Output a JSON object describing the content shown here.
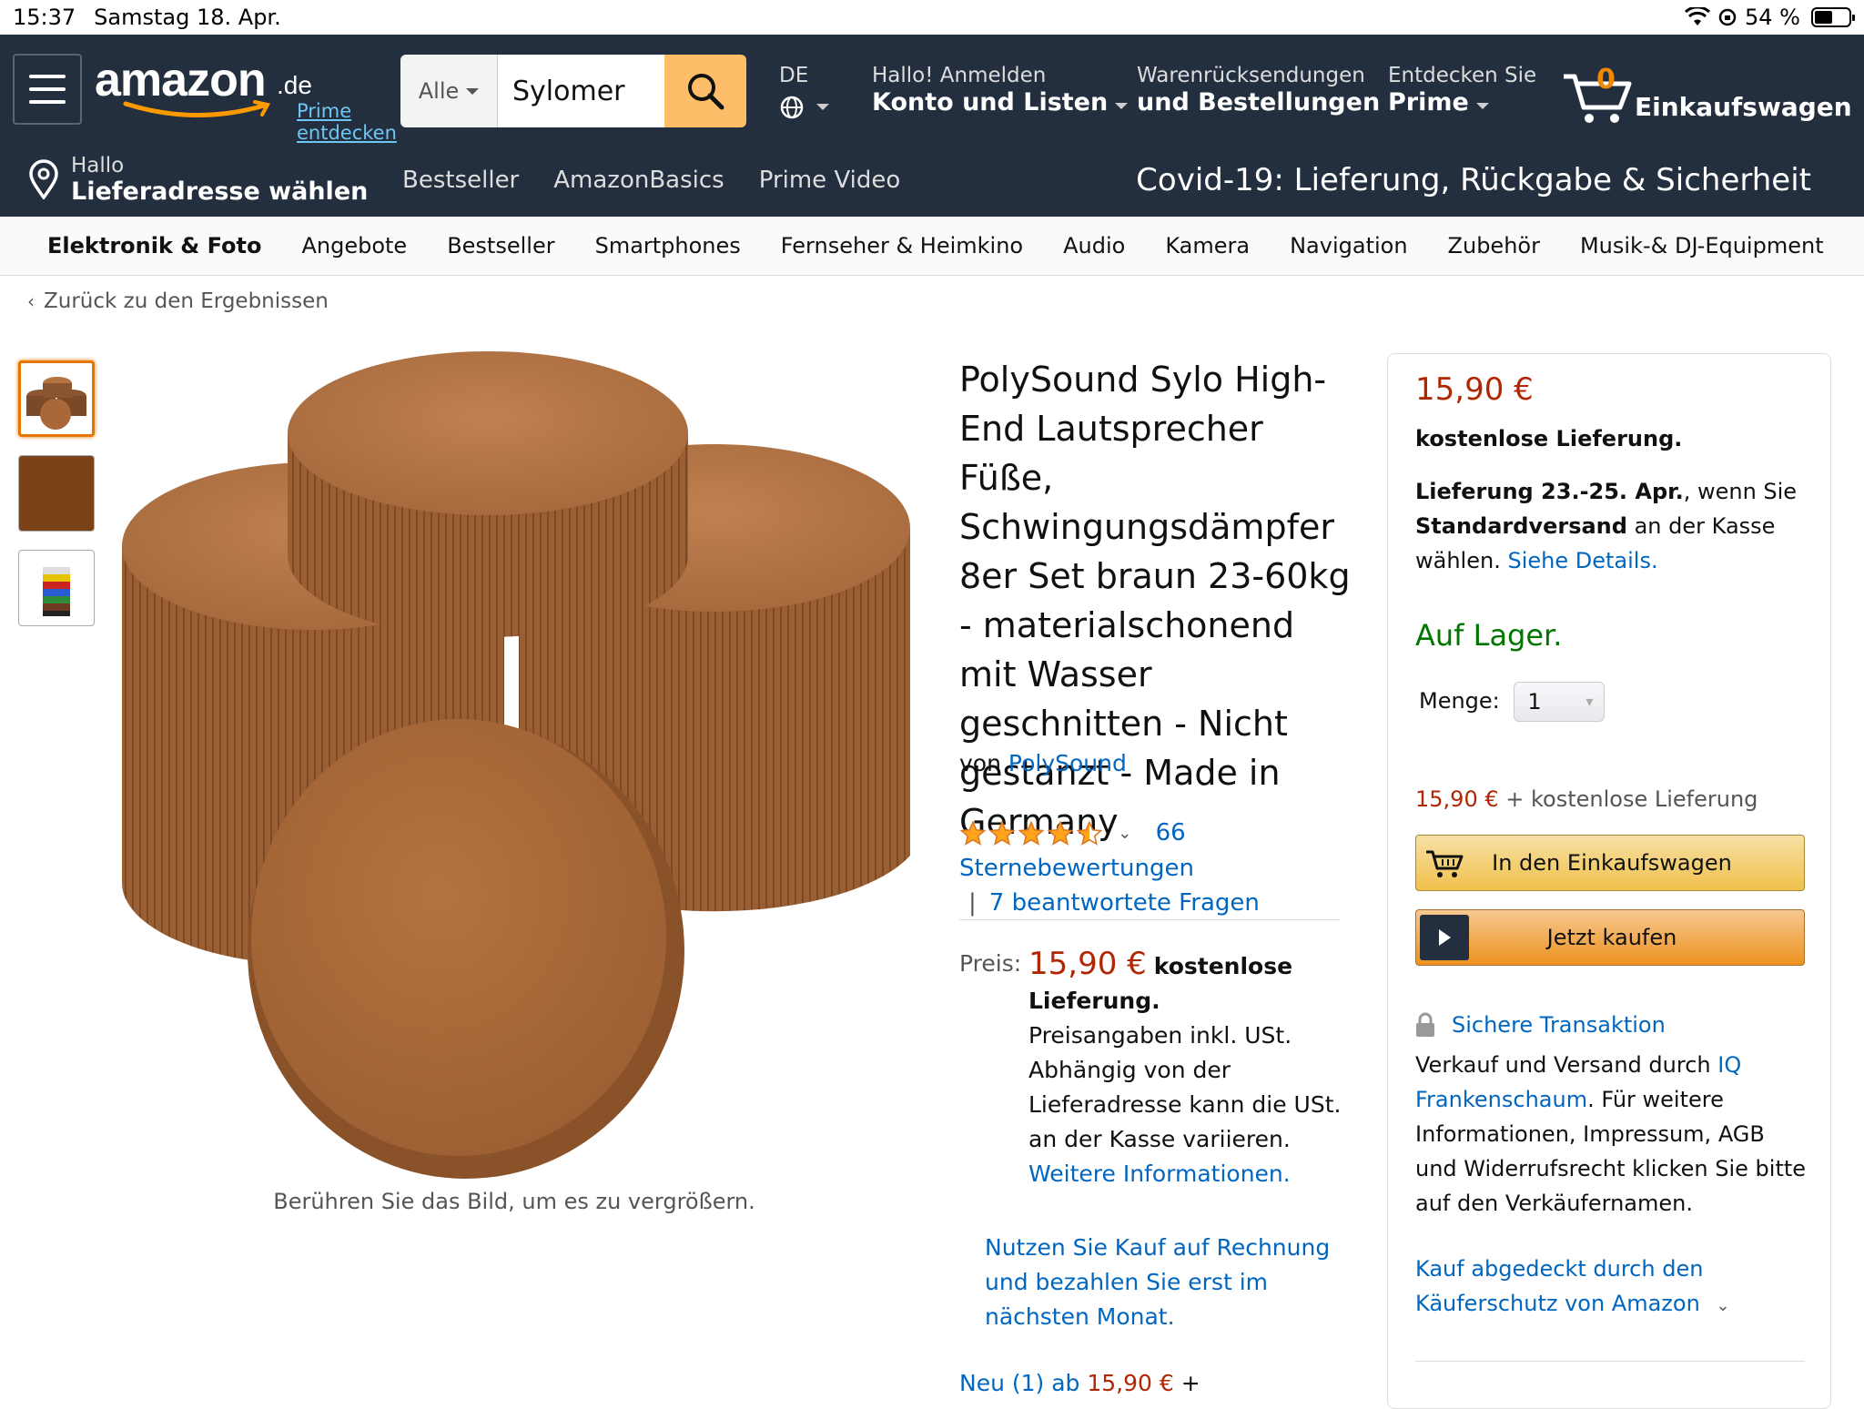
{
  "status": {
    "time": "15:37",
    "date": "Samstag 18. Apr.",
    "battery": "54 %",
    "battery_level": 0.54
  },
  "header": {
    "logo_text": "amazon",
    "logo_tld": ".de",
    "prime_link": "Prime entdecken",
    "search": {
      "department": "Alle",
      "query": "Sylomer"
    },
    "language": "DE",
    "account": {
      "line1": "Hallo! Anmelden",
      "line2": "Konto und Listen"
    },
    "orders": {
      "line1": "Warenrücksendungen",
      "line2": "und Bestellungen"
    },
    "prime": {
      "line1": "Entdecken Sie",
      "line2": "Prime"
    },
    "cart": {
      "count": "0",
      "label": "Einkaufswagen"
    }
  },
  "subnav": {
    "location": {
      "line1": "Hallo",
      "line2": "Lieferadresse wählen"
    },
    "links": [
      "Bestseller",
      "AmazonBasics",
      "Prime Video"
    ],
    "banner": "Covid-19: Lieferung, Rückgabe & Sicherheit"
  },
  "categories": [
    "Elektronik & Foto",
    "Angebote",
    "Bestseller",
    "Smartphones",
    "Fernseher & Heimkino",
    "Audio",
    "Kamera",
    "Navigation",
    "Zubehör",
    "Musik-& DJ-Equipment"
  ],
  "back_link": "Zurück zu den Ergebnissen",
  "image_caption": "Berühren Sie das Bild, um es zu vergrößern.",
  "product": {
    "title": "PolySound Sylo High-End Lautsprecher Füße, Schwingungsdämpfer 8er Set braun 23-60kg - materialschonend mit Wasser geschnitten - Nicht gestanzt - Made in Germany",
    "by_label": "von",
    "brand": "PolySound",
    "rating_stars": 4.5,
    "rating_count": "66",
    "rating_label": "Sternebewertungen",
    "questions": "7 beantwortete Fragen",
    "price_label": "Preis:",
    "price": "15,90 €",
    "free_delivery": "kostenlose Lieferung.",
    "tax_note": "Preisangaben inkl. USt. Abhängig von der Lieferadresse kann die USt. an der Kasse variieren.",
    "more_info": "Weitere Informationen.",
    "invoice_promo": "Nutzen Sie Kauf auf Rechnung und bezahlen Sie erst im nächsten Monat.",
    "new_offers": "Neu (1) ab",
    "new_price": "15,90 €",
    "new_suffix": "+"
  },
  "buybox": {
    "price": "15,90 €",
    "free_delivery": "kostenlose Lieferung.",
    "delivery_bold": "Lieferung 23.-25. Apr.",
    "delivery_mid": ", wenn Sie",
    "delivery_shipping": "Standardversand",
    "delivery_rest": "an der Kasse wählen.",
    "details_link": "Siehe Details.",
    "stock": "Auf Lager.",
    "qty_label": "Menge:",
    "qty_value": "1",
    "summary_price": "15,90 €",
    "summary_rest": "+ kostenlose Lieferung",
    "add_to_cart": "In den Einkaufswagen",
    "buy_now": "Jetzt kaufen",
    "secure": "Sichere Transaktion",
    "seller_prefix": "Verkauf und Versand durch",
    "seller_name": "IQ Frankenschaum",
    "seller_suffix": ". Für weitere Informationen, Impressum, AGB und Widerrufsrecht klicken Sie bitte auf den Verkäufernamen.",
    "protection": "Kauf abgedeckt durch den Käuferschutz von Amazon"
  },
  "colors": {
    "nav_bg": "#232f3e",
    "accent": "#febd69",
    "price_red": "#b12704",
    "stock_green": "#007600",
    "link": "#0066c0",
    "foam": "#a8683a"
  }
}
